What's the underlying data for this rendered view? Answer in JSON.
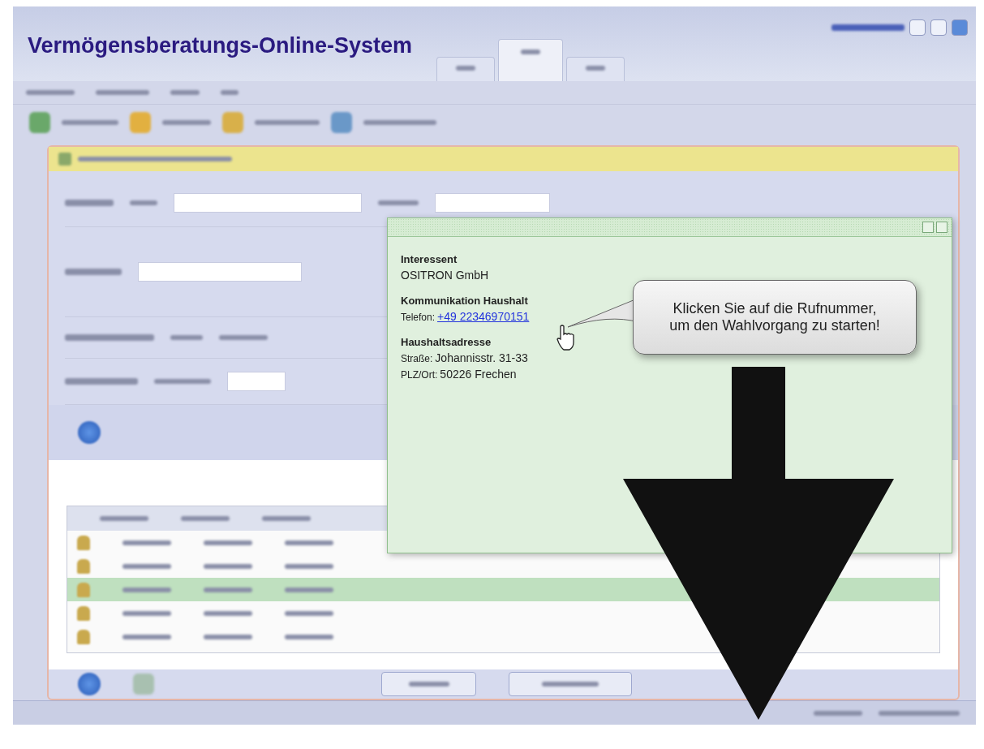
{
  "window": {
    "title": "Vermögensberatungs-Online-System"
  },
  "tabs": [
    {
      "selected": false
    },
    {
      "selected": true
    },
    {
      "selected": false
    }
  ],
  "table": {
    "rows": [
      {
        "selected": false
      },
      {
        "selected": false
      },
      {
        "selected": true
      },
      {
        "selected": false
      },
      {
        "selected": false
      }
    ]
  },
  "popup": {
    "sections": [
      {
        "heading": "Interessent",
        "lines": [
          {
            "value": "OSITRON GmbH"
          }
        ]
      },
      {
        "heading": "Kommunikation Haushalt",
        "lines": [
          {
            "label": "Telefon:",
            "value": "+49 22346970151",
            "kind": "link"
          }
        ]
      },
      {
        "heading": "Haushaltsadresse",
        "lines": [
          {
            "label": "Straße:",
            "value": "Johannisstr. 31-33",
            "kind": "text"
          },
          {
            "label": "PLZ/Ort:",
            "value": "50226 Frechen",
            "kind": "text"
          }
        ]
      }
    ]
  },
  "callout": {
    "text": "Klicken Sie auf die Rufnummer, um den Wahlvorgang zu starten!"
  }
}
